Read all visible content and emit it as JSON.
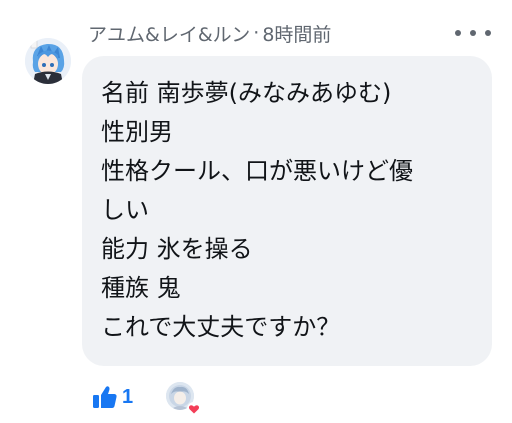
{
  "comment": {
    "author": "アユム&レイ&ルン",
    "separator": "·",
    "time": "8時間前",
    "lines": [
      "名前 南歩夢(みなみあゆむ)",
      "性別男",
      "性格クール、口が悪いけど優",
      "しい",
      "能力 氷を操る",
      "種族 鬼",
      "これで大丈夫ですか？"
    ],
    "likes": "1"
  },
  "icons": {
    "avatar": "anime-avatar-icon",
    "more": "more-options-icon",
    "like": "thumbs-up-icon",
    "reactor": "reactor-avatar-icon",
    "heart": "heart-icon"
  },
  "colors": {
    "bubble": "#f0f2f5",
    "meta_text": "#606770",
    "like_blue": "#1877f2",
    "heart_red": "#f33e58"
  }
}
